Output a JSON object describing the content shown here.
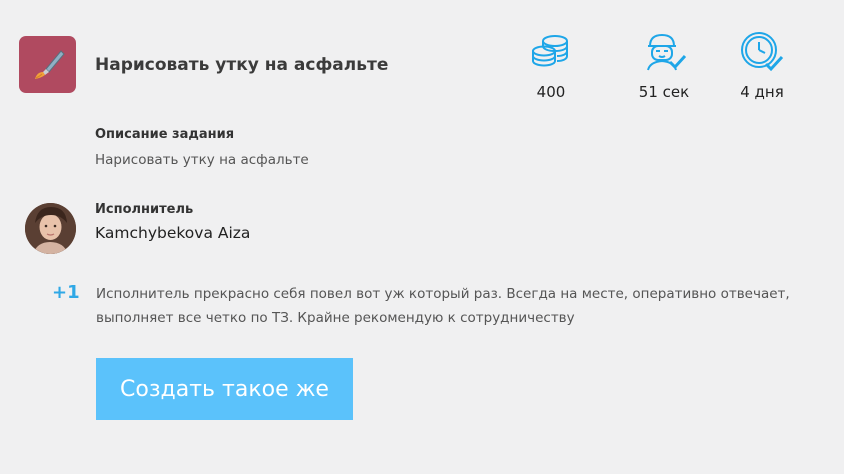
{
  "task": {
    "title": "Нарисовать утку на асфальте"
  },
  "stats": {
    "coins": "400",
    "time": "51 сек",
    "days": "4 дня"
  },
  "description": {
    "label": "Описание задания",
    "text": "Нарисовать утку на асфальте"
  },
  "executor": {
    "label": "Исполнитель",
    "name": "Kamchybekova Aiza"
  },
  "review": {
    "score": "+1",
    "text": "Исполнитель прекрасно себя повел вот уж который раз. Всегда на месте, оперативно отвечает, выполняет все четко по ТЗ. Крайне рекомендую к сотрудничеству"
  },
  "actions": {
    "create_label": "Создать такое же"
  },
  "colors": {
    "accent": "#5bc2fb",
    "task_icon_bg": "#b04a60",
    "score": "#2fa8e6"
  },
  "icons": {
    "task": "paintbrush-icon",
    "coins": "coins-stack-icon",
    "time": "worker-check-icon",
    "days": "clock-check-icon"
  }
}
